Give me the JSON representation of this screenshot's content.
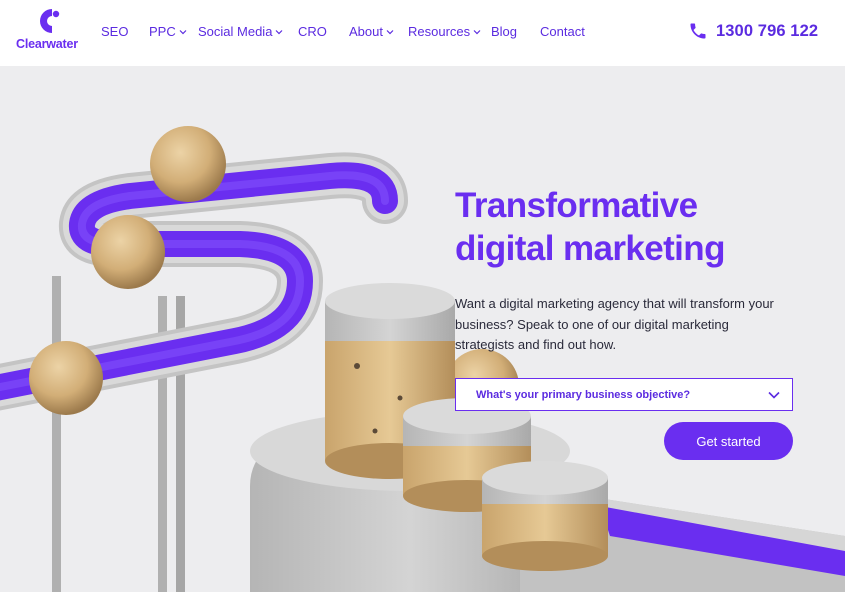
{
  "brand": {
    "name": "Clearwater",
    "accent": "#6a2ef0"
  },
  "nav": {
    "items": [
      {
        "label": "SEO",
        "has_dropdown": false
      },
      {
        "label": "PPC",
        "has_dropdown": true
      },
      {
        "label": "Social Media",
        "has_dropdown": true
      },
      {
        "label": "CRO",
        "has_dropdown": false
      },
      {
        "label": "About",
        "has_dropdown": true
      },
      {
        "label": "Resources",
        "has_dropdown": true
      },
      {
        "label": "Blog",
        "has_dropdown": false
      },
      {
        "label": "Contact",
        "has_dropdown": false
      }
    ],
    "phone": "1300 796 122",
    "phone_icon": "phone-icon",
    "chevron_icon": "chevron-down-icon"
  },
  "hero": {
    "headline_line1": "Transformative",
    "headline_line2": "digital marketing",
    "subtext": "Want a digital marketing agency that will transform your business? Speak to one of our digital marketing strategists and find out how.",
    "select": {
      "value": "What's your primary business objective?"
    },
    "cta_label": "Get started",
    "colors": {
      "background": "#ededef",
      "track": "#6a2ef0",
      "concrete": "#c9c9c9",
      "wood": "#d9b98a"
    }
  }
}
